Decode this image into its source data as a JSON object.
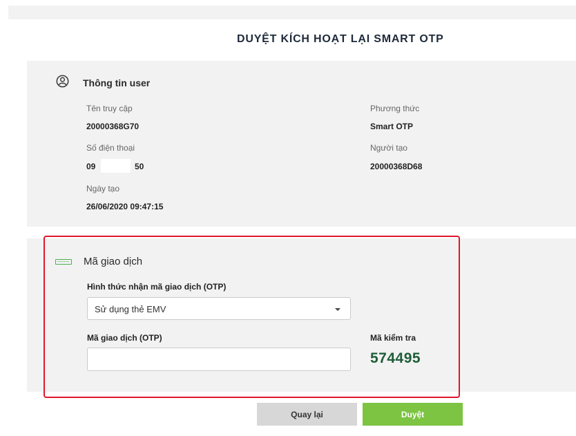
{
  "page": {
    "title": "DUYỆT KÍCH HOẠT LẠI SMART OTP"
  },
  "user_info": {
    "section_title": "Thông tin user",
    "username_label": "Tên truy cập",
    "username_value": "20000368G70",
    "phone_label": "Số điện thoại",
    "phone_prefix": "09",
    "phone_suffix": "50",
    "created_date_label": "Ngày tạo",
    "created_date_value": "26/06/2020 09:47:15",
    "method_label": "Phương thức",
    "method_value": "Smart OTP",
    "creator_label": "Người tạo",
    "creator_value": "20000368D68"
  },
  "transaction": {
    "section_title": "Mã giao dịch",
    "otp_method_label": "Hình thức nhận mã giao dịch (OTP)",
    "otp_method_selected": "Sử dụng thẻ EMV",
    "otp_code_label": "Mã giao dịch (OTP)",
    "otp_code_value": "",
    "check_code_label": "Mã kiểm tra",
    "check_code_value": "574495"
  },
  "buttons": {
    "back_label": "Quay lại",
    "approve_label": "Duyệt"
  },
  "colors": {
    "accent_green": "#7cc442",
    "check_code_green": "#1e5e38",
    "highlight_red": "#e0162b",
    "panel_gray": "#f2f2f2"
  },
  "icons": {
    "user_section": "user-circle-icon",
    "transaction_section": "card-icon",
    "select_caret": "chevron-down-icon"
  }
}
